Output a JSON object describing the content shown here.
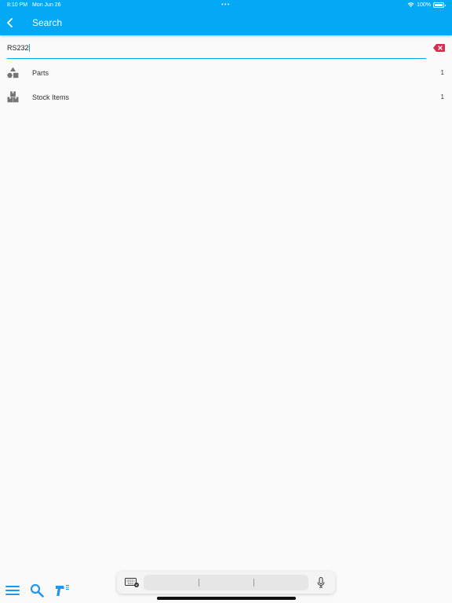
{
  "status_bar": {
    "time": "8:10 PM",
    "date": "Mon Jun 26",
    "battery": "100%",
    "dots": "•••"
  },
  "header": {
    "title": "Search",
    "back_icon": "chevron-left-icon"
  },
  "search": {
    "value": "RS232",
    "clear_icon": "backspace-clear-icon"
  },
  "results": [
    {
      "label": "Parts",
      "count": "1",
      "icon": "shapes-icon"
    },
    {
      "label": "Stock Items",
      "count": "1",
      "icon": "boxes-icon"
    }
  ],
  "bottom_nav": {
    "items": [
      {
        "icon": "menu-icon"
      },
      {
        "icon": "search-icon"
      },
      {
        "icon": "barcode-scanner-icon"
      }
    ]
  },
  "colors": {
    "accent": "#03a9f4",
    "clear_button": "#d32f4f",
    "icon_gray": "#757575"
  }
}
